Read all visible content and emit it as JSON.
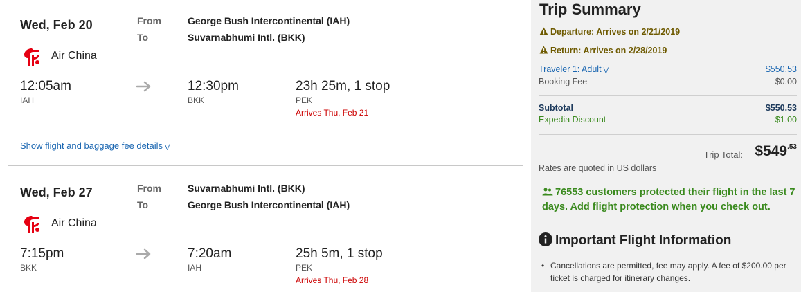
{
  "legs": [
    {
      "date": "Wed, Feb 20",
      "from_label": "From",
      "to_label": "To",
      "from_airport": "George Bush Intercontinental (IAH)",
      "to_airport": "Suvarnabhumi Intl. (BKK)",
      "airline": "Air China",
      "depart_time": "12:05am",
      "depart_code": "IAH",
      "arrive_time": "12:30pm",
      "arrive_code": "BKK",
      "duration": "23h 25m, 1 stop",
      "stop_code": "PEK",
      "arrives_note": "Arrives Thu, Feb 21",
      "details_link": "Show flight and baggage fee details"
    },
    {
      "date": "Wed, Feb 27",
      "from_label": "From",
      "to_label": "To",
      "from_airport": "Suvarnabhumi Intl. (BKK)",
      "to_airport": "George Bush Intercontinental (IAH)",
      "airline": "Air China",
      "depart_time": "7:15pm",
      "depart_code": "BKK",
      "arrive_time": "7:20am",
      "arrive_code": "IAH",
      "duration": "25h 5m, 1 stop",
      "stop_code": "PEK",
      "arrives_note": "Arrives Thu, Feb 28"
    }
  ],
  "summary": {
    "title": "Trip Summary",
    "departure_warning": "Departure: Arrives on 2/21/2019",
    "return_warning": "Return: Arrives on 2/28/2019",
    "traveler_label": "Traveler 1: Adult",
    "traveler_price": "$550.53",
    "booking_fee_label": "Booking Fee",
    "booking_fee": "$0.00",
    "subtotal_label": "Subtotal",
    "subtotal": "$550.53",
    "discount_label": "Expedia Discount",
    "discount": "-$1.00",
    "trip_total_label": "Trip Total:",
    "trip_total_whole": "$549",
    "trip_total_cents": ".53",
    "rates_note": "Rates are quoted in US dollars",
    "protection_text": "76553 customers protected their flight in the last 7 days. Add flight protection when you check out.",
    "info_heading": "Important Flight Information",
    "info_bullet": "Cancellations are permitted, fee may apply. A fee of $200.00 per ticket is charged for itinerary changes."
  },
  "icons": {
    "airline_logo": "air-china-logo",
    "arrow": "right-arrow-icon",
    "warning": "warning-triangle-icon",
    "people": "people-icon",
    "info": "info-circle-icon",
    "chevron": "double-chevron-down-icon"
  },
  "colors": {
    "link_blue": "#1a66b1",
    "warning_brown": "#6e5a00",
    "green": "#3a8a1e",
    "red": "#cc0000",
    "panel_bg": "#f1f1f1",
    "logo_red": "#e60012"
  }
}
